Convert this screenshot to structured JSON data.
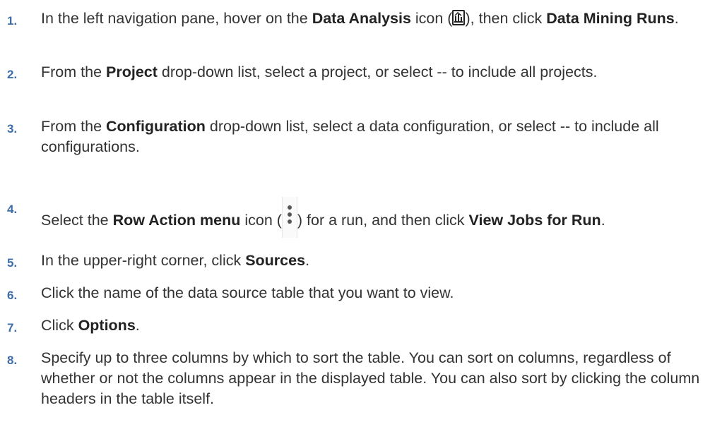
{
  "steps": [
    {
      "num": "1.",
      "parts": {
        "a": "In the left navigation pane, hover on the ",
        "b": "Data Analysis",
        "c": " icon (",
        "icon": "data-analysis-icon",
        "d": "), then click ",
        "e": "Data Mining Runs",
        "f": "."
      }
    },
    {
      "num": "2.",
      "parts": {
        "a": "From the ",
        "b": "Project",
        "c": " drop-down list, select a project, or select -- to include all projects."
      }
    },
    {
      "num": "3.",
      "parts": {
        "a": "From the ",
        "b": "Configuration",
        "c": " drop-down list, select a data configuration, or select -- to include all configurations."
      }
    },
    {
      "num": "4.",
      "parts": {
        "a": "Select the ",
        "b": "Row Action menu",
        "c": " icon (",
        "icon": "row-action-menu-icon",
        "d": ") for a run, and then click ",
        "e": "View Jobs for Run",
        "f": "."
      }
    },
    {
      "num": "5.",
      "parts": {
        "a": "In the upper-right corner, click ",
        "b": "Sources",
        "c": "."
      }
    },
    {
      "num": "6.",
      "parts": {
        "a": "Click the name of the data source table that you want to view."
      }
    },
    {
      "num": "7.",
      "parts": {
        "a": "Click ",
        "b": "Options",
        "c": "."
      }
    },
    {
      "num": "8.",
      "parts": {
        "a": "Specify up to three columns by which to sort the table. You can sort on columns, regardless of whether or not the columns appear in the displayed table. You can also sort by clicking the column headers in the table itself."
      }
    }
  ],
  "colors": {
    "step_number": "#3d6ea8",
    "text": "#333333"
  }
}
